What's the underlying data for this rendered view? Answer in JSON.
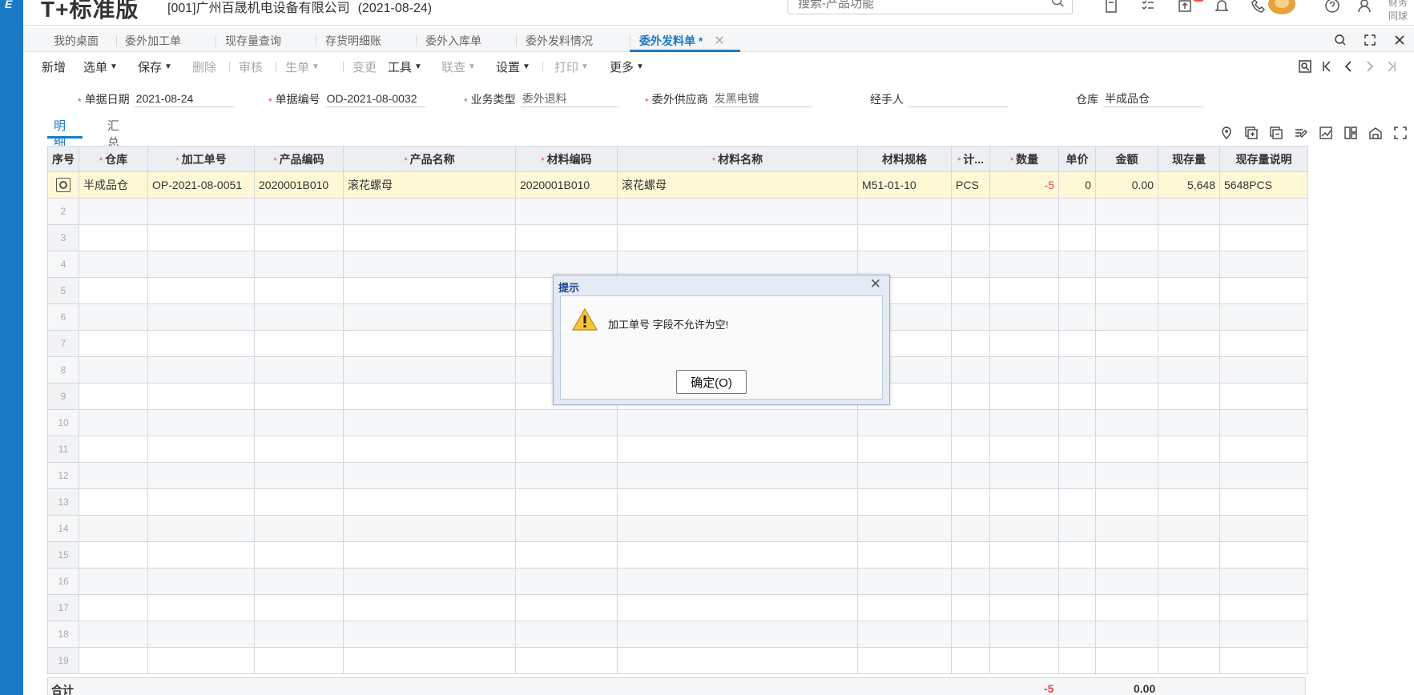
{
  "header": {
    "brand": "T+标准版",
    "company": "[001]广州百晟机电设备有限公司",
    "date": "(2021-08-24)",
    "search_placeholder": "搜索-产品功能",
    "user_name": "财务同球"
  },
  "tabs": [
    {
      "label": "我的桌面"
    },
    {
      "label": "委外加工单"
    },
    {
      "label": "现存量查询"
    },
    {
      "label": "存货明细账"
    },
    {
      "label": "委外入库单"
    },
    {
      "label": "委外发料情况"
    },
    {
      "label": "委外发料单 *"
    }
  ],
  "toolbar": {
    "new": "新增",
    "select": "选单",
    "save": "保存",
    "delete": "删除",
    "audit": "审核",
    "generate": "生单",
    "change": "变更",
    "tools": "工具",
    "link": "联查",
    "settings": "设置",
    "print": "打印",
    "more": "更多"
  },
  "form": {
    "doc_date_label": "单据日期",
    "doc_date": "2021-08-24",
    "doc_no_label": "单据编号",
    "doc_no": "OD-2021-08-0032",
    "biz_type_label": "业务类型",
    "biz_type": "委外退料",
    "supplier_label": "委外供应商",
    "supplier": "发黑电镀",
    "handler_label": "经手人",
    "handler": "",
    "warehouse_label": "仓库",
    "warehouse": "半成品仓"
  },
  "subtabs": {
    "detail": "明细",
    "summary": "汇总"
  },
  "grid": {
    "headers": {
      "idx": "序号",
      "warehouse": "仓库",
      "order_no": "加工单号",
      "product_code": "产品编码",
      "product_name": "产品名称",
      "material_code": "材料编码",
      "material_name": "材料名称",
      "spec": "材料规格",
      "unit": "计...",
      "qty": "数量",
      "price": "单价",
      "amount": "金额",
      "stock": "现存量",
      "stock_desc": "现存量说明"
    },
    "row1": {
      "warehouse": "半成品仓",
      "order_no": "OP-2021-08-0051",
      "product_code": "2020001B010",
      "product_name": "滚花螺母",
      "material_code": "2020001B010",
      "material_name": "滚花螺母",
      "spec": "M51-01-10",
      "unit": "PCS",
      "qty": "-5",
      "price": "0",
      "amount": "0.00",
      "stock": "5,648",
      "stock_desc": "5648PCS"
    },
    "row_numbers": [
      "2",
      "3",
      "4",
      "5",
      "6",
      "7",
      "8",
      "9",
      "10",
      "11",
      "12",
      "13",
      "14",
      "15",
      "16",
      "17",
      "18",
      "19"
    ]
  },
  "totals": {
    "label": "合计",
    "qty": "-5",
    "amount": "0.00"
  },
  "dialog": {
    "title": "提示",
    "message": "加工单号 字段不允许为空!",
    "ok": "确定(O)"
  }
}
